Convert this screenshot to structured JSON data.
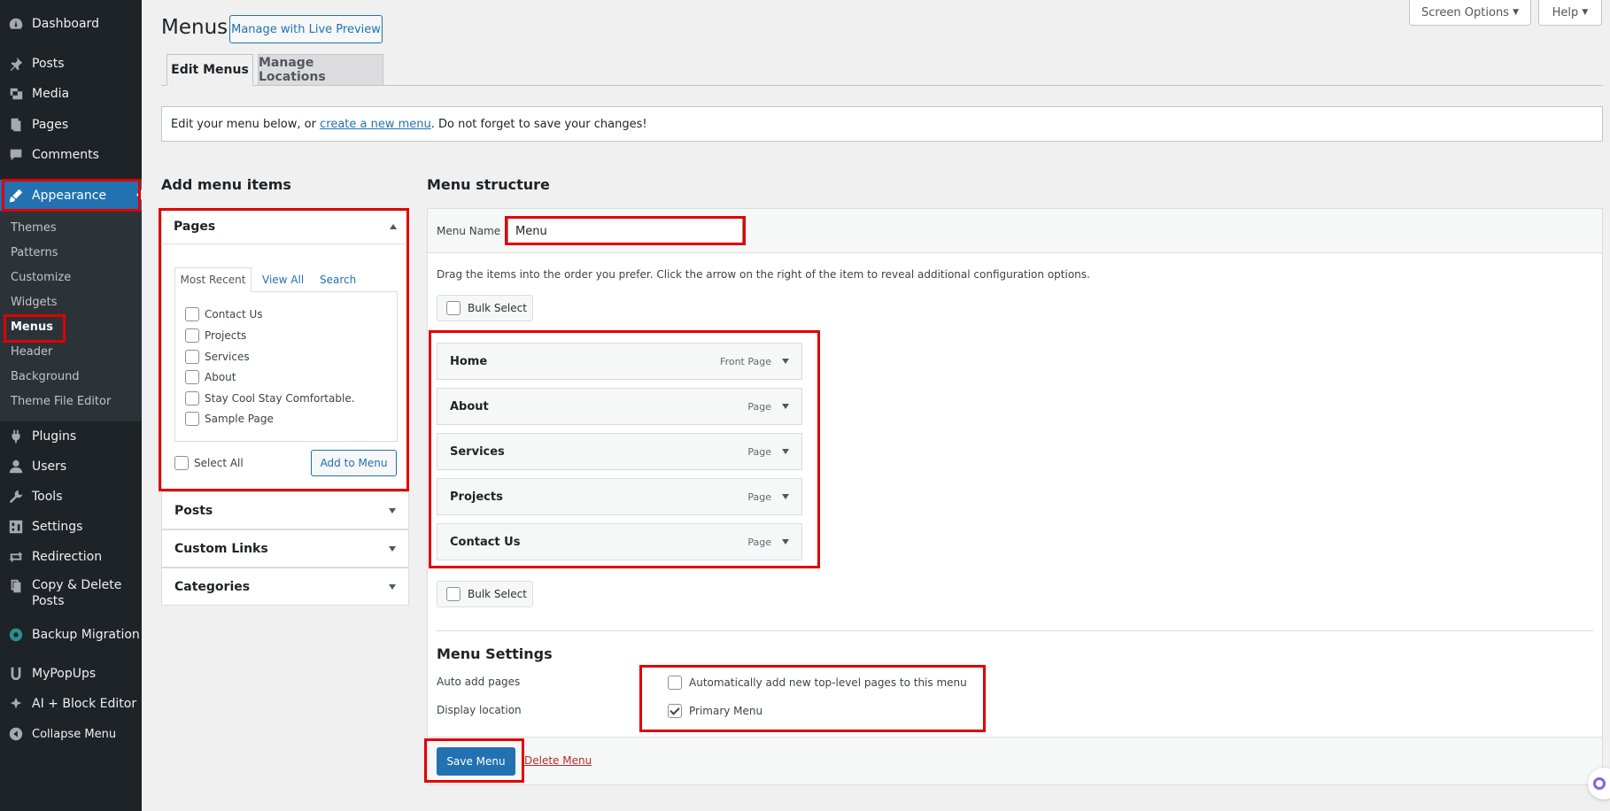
{
  "sidebar": {
    "items": [
      {
        "label": "Dashboard",
        "icon": "dashboard-icon"
      },
      {
        "label": "Posts",
        "icon": "pin-icon"
      },
      {
        "label": "Media",
        "icon": "media-icon"
      },
      {
        "label": "Pages",
        "icon": "pages-icon"
      },
      {
        "label": "Comments",
        "icon": "comment-icon"
      },
      {
        "label": "Appearance",
        "icon": "brush-icon"
      },
      {
        "label": "Plugins",
        "icon": "plugin-icon"
      },
      {
        "label": "Users",
        "icon": "user-icon"
      },
      {
        "label": "Tools",
        "icon": "wrench-icon"
      },
      {
        "label": "Settings",
        "icon": "settings-icon"
      },
      {
        "label": "Redirection",
        "icon": "redirect-icon"
      },
      {
        "label": "Copy & Delete Posts",
        "icon": "copy-icon"
      },
      {
        "label": "Backup Migration",
        "icon": "backup-icon"
      },
      {
        "label": "MyPopUps",
        "icon": "popup-icon"
      },
      {
        "label": "AI + Block Editor",
        "icon": "ai-icon"
      },
      {
        "label": "Collapse Menu",
        "icon": "collapse-icon"
      }
    ],
    "submenu": [
      "Themes",
      "Patterns",
      "Customize",
      "Widgets",
      "Menus",
      "Header",
      "Background",
      "Theme File Editor"
    ],
    "accent": "#2271b1"
  },
  "header": {
    "title": "Menus",
    "live_preview": "Manage with Live Preview",
    "screen_options": "Screen Options",
    "help": "Help",
    "tabs": [
      "Edit Menus",
      "Manage Locations"
    ]
  },
  "notice": {
    "prefix": "Edit your menu below, or ",
    "link": "create a new menu",
    "suffix": ". Do not forget to save your changes!"
  },
  "add_items": {
    "heading": "Add menu items",
    "pages_title": "Pages",
    "tabs": [
      "Most Recent",
      "View All",
      "Search"
    ],
    "pages": [
      "Contact Us",
      "Projects",
      "Services",
      "About",
      "Stay Cool Stay Comfortable.",
      "Sample Page"
    ],
    "select_all": "Select All",
    "add_button": "Add to Menu",
    "sections": [
      "Posts",
      "Custom Links",
      "Categories"
    ]
  },
  "structure": {
    "heading": "Menu structure",
    "name_label": "Menu Name",
    "name_value": "Menu",
    "instructions": "Drag the items into the order you prefer. Click the arrow on the right of the item to reveal additional configuration options.",
    "bulk_select": "Bulk Select",
    "items": [
      {
        "title": "Home",
        "type": "Front Page"
      },
      {
        "title": "About",
        "type": "Page"
      },
      {
        "title": "Services",
        "type": "Page"
      },
      {
        "title": "Projects",
        "type": "Page"
      },
      {
        "title": "Contact Us",
        "type": "Page"
      }
    ]
  },
  "settings": {
    "heading": "Menu Settings",
    "auto_add_label": "Auto add pages",
    "auto_add_text": "Automatically add new top-level pages to this menu",
    "auto_add_checked": false,
    "display_label": "Display location",
    "primary_text": "Primary Menu",
    "primary_checked": true
  },
  "footer": {
    "save": "Save Menu",
    "delete": "Delete Menu"
  }
}
